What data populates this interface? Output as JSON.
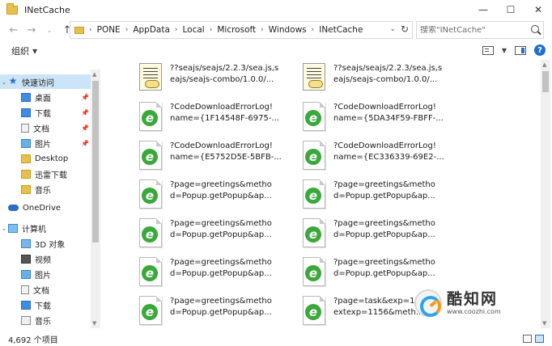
{
  "window": {
    "title": "INetCache"
  },
  "address": {
    "crumbs": [
      "PONE",
      "AppData",
      "Local",
      "Microsoft",
      "Windows",
      "INetCache"
    ]
  },
  "search": {
    "placeholder": "搜索\"INetCache\""
  },
  "toolbar": {
    "organize_label": "组织"
  },
  "nav": {
    "quick_access": "快速访问",
    "items": [
      {
        "label": "桌面",
        "icon": "desktop-icon",
        "pinned": true
      },
      {
        "label": "下载",
        "icon": "download-folder-icon",
        "pinned": true
      },
      {
        "label": "文档",
        "icon": "document-icon",
        "pinned": true
      },
      {
        "label": "图片",
        "icon": "picture-icon",
        "pinned": true
      },
      {
        "label": "Desktop",
        "icon": "folder-icon",
        "pinned": false
      },
      {
        "label": "迅雷下载",
        "icon": "folder-icon",
        "pinned": false
      },
      {
        "label": "音乐",
        "icon": "music-icon",
        "pinned": false
      }
    ],
    "onedrive": "OneDrive",
    "this_pc": "计算机",
    "pc_items": [
      {
        "label": "3D 对象",
        "icon": "3d-objects-icon"
      },
      {
        "label": "视频",
        "icon": "video-icon"
      },
      {
        "label": "图片",
        "icon": "picture-icon"
      },
      {
        "label": "文档",
        "icon": "document-icon"
      },
      {
        "label": "下载",
        "icon": "download-folder-icon"
      },
      {
        "label": "音乐",
        "icon": "music-icon"
      }
    ]
  },
  "files": [
    {
      "line1": "??seajs/seajs/2.2.3/sea.js,s",
      "line2": "eajs/seajs-combo/1.0.0/...",
      "icon": "script-file-icon"
    },
    {
      "line1": "??seajs/seajs/2.2.3/sea.js,s",
      "line2": "eajs/seajs-combo/1.0.0/...",
      "icon": "script-file-icon"
    },
    {
      "line1": "?CodeDownloadErrorLog!",
      "line2": "name={1F14548F-6975-...",
      "icon": "ie-file-icon"
    },
    {
      "line1": "?CodeDownloadErrorLog!",
      "line2": "name={5DA34F59-FBFF-...",
      "icon": "ie-file-icon"
    },
    {
      "line1": "?CodeDownloadErrorLog!",
      "line2": "name={E5752D5E-5BFB-...",
      "icon": "ie-file-icon"
    },
    {
      "line1": "?CodeDownloadErrorLog!",
      "line2": "name={EC336339-69E2-...",
      "icon": "ie-file-icon"
    },
    {
      "line1": "?page=greetings&metho",
      "line2": "d=Popup.getPopup&ap...",
      "icon": "ie-file-icon"
    },
    {
      "line1": "?page=greetings&metho",
      "line2": "d=Popup.getPopup&ap...",
      "icon": "ie-file-icon"
    },
    {
      "line1": "?page=greetings&metho",
      "line2": "d=Popup.getPopup&ap...",
      "icon": "ie-file-icon"
    },
    {
      "line1": "?page=greetings&metho",
      "line2": "d=Popup.getPopup&ap...",
      "icon": "ie-file-icon"
    },
    {
      "line1": "?page=greetings&metho",
      "line2": "d=Popup.getPopup&ap...",
      "icon": "ie-file-icon"
    },
    {
      "line1": "?page=greetings&metho",
      "line2": "d=Popup.getPopup&ap...",
      "icon": "ie-file-icon"
    },
    {
      "line1": "?page=greetings&metho",
      "line2": "d=Popup.getPopup&ap...",
      "icon": "ie-file-icon"
    },
    {
      "line1": "?page=task&exp=11",
      "line2": "extexp=1156&meth...",
      "icon": "ie-file-icon"
    }
  ],
  "status": {
    "count": "4,692 个项目"
  },
  "watermark": {
    "name": "酷知网",
    "url": "www.coozhi.com"
  },
  "colors": {
    "accent": "#2a6cc8",
    "selection": "#cce4f7",
    "ie_green": "#3aa83a"
  }
}
